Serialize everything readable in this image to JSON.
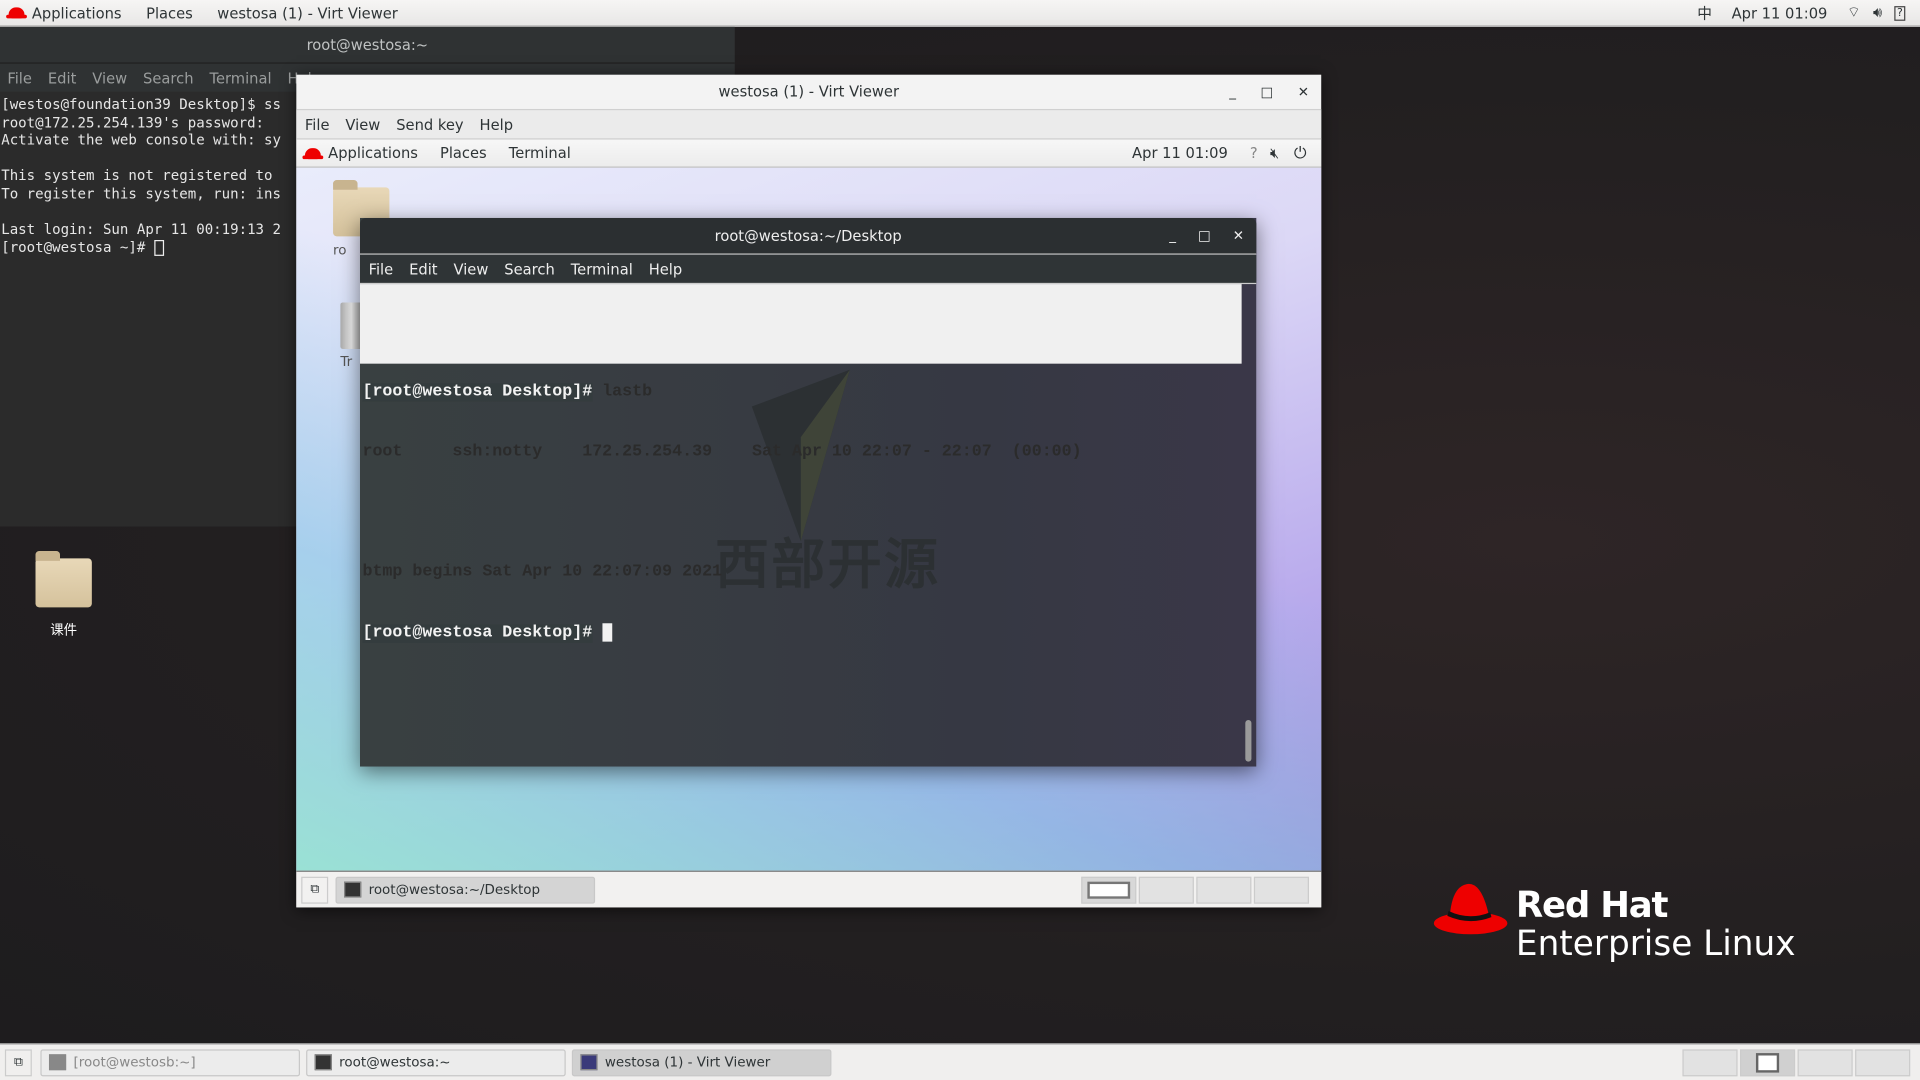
{
  "topbar": {
    "applications": "Applications",
    "places": "Places",
    "window_title": "westosa (1) - Virt Viewer",
    "input_method": "中",
    "clock": "Apr 11  01:09",
    "icons": [
      "wifi-icon",
      "volume-icon",
      "battery-unknown-icon"
    ]
  },
  "outer_terminal": {
    "title": "root@westosa:~",
    "menu": [
      "File",
      "Edit",
      "View",
      "Search",
      "Terminal",
      "Help"
    ],
    "lines": [
      "[westos@foundation39 Desktop]$ ss",
      "root@172.25.254.139's password: ",
      "Activate the web console with: sy",
      "",
      "This system is not registered to ",
      "To register this system, run: ins",
      "",
      "Last login: Sun Apr 11 00:19:13 2",
      "[root@westosa ~]# "
    ]
  },
  "desktop": {
    "folder_label": "课件"
  },
  "virt_viewer": {
    "title": "westosa (1) - Virt Viewer",
    "menu": [
      "File",
      "View",
      "Send key",
      "Help"
    ],
    "guest": {
      "topbar": {
        "applications": "Applications",
        "places": "Places",
        "terminal": "Terminal",
        "clock": "Apr 11  01:09"
      },
      "icons": {
        "home_label": "ro",
        "trash_label": "Tr"
      },
      "terminal": {
        "title": "root@westosa:~/Desktop",
        "menu": [
          "File",
          "Edit",
          "View",
          "Search",
          "Terminal",
          "Help"
        ],
        "prompt": "[root@westosa Desktop]#",
        "command": " lastb",
        "output": [
          "root     ssh:notty    172.25.254.39    Sat Apr 10 22:07 - 22:07  (00:00)",
          "",
          "btmp begins Sat Apr 10 22:07:09 2021"
        ],
        "watermark": "西部开源"
      },
      "taskbar": {
        "item": "root@westosa:~/Desktop",
        "workspaces": 4,
        "active_workspace": 1
      }
    }
  },
  "taskbar": {
    "items": [
      "[root@westosb:~]",
      "root@westosa:~",
      "westosa (1) - Virt Viewer"
    ],
    "workspaces": 4,
    "active_workspace": 2
  },
  "branding": {
    "line1": "Red Hat",
    "line2": "Enterprise Linux",
    "color": "#ee0000"
  }
}
